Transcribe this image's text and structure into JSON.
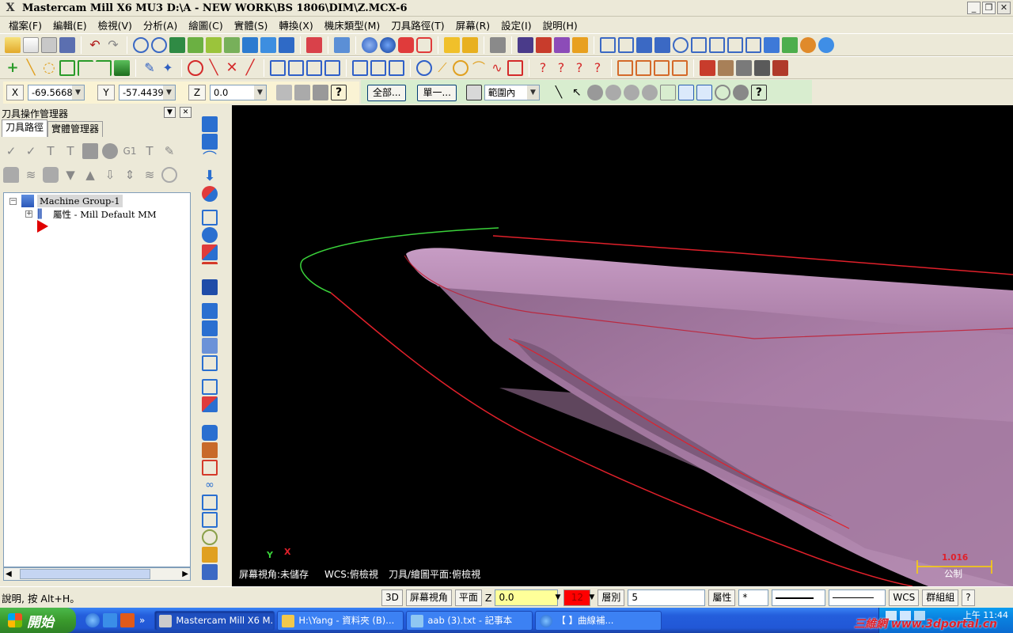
{
  "window": {
    "title": "Mastercam Mill X6 MU3  D:\\A - NEW WORK\\BS 1806\\DIM\\Z.MCX-6"
  },
  "menu": [
    "檔案(F)",
    "編輯(E)",
    "檢視(V)",
    "分析(A)",
    "繪圖(C)",
    "實體(S)",
    "轉換(X)",
    "機床類型(M)",
    "刀具路徑(T)",
    "屏幕(R)",
    "設定(I)",
    "說明(H)"
  ],
  "coords": {
    "x_label": "X",
    "x_value": "-69.56687",
    "y_label": "Y",
    "y_value": "-57.44398",
    "z_label": "Z",
    "z_value": "0.0"
  },
  "selection": {
    "all_button": "全部...",
    "single_button": "單一...",
    "mode": "範圍內"
  },
  "panel": {
    "title": "刀具操作管理器",
    "tabs": [
      "刀具路徑",
      "實體管理器"
    ],
    "tree": {
      "group": "Machine Group-1",
      "properties": "屬性 - Mill Default MM"
    }
  },
  "viewport": {
    "status_view": "屏幕視角:未儲存",
    "status_wcs": "WCS:俯檢視",
    "status_plane": "刀具/繪圖平面:俯檢視",
    "scale_value": "1.016",
    "scale_unit": "公制",
    "axis_y": "Y",
    "axis_x": "X"
  },
  "status": {
    "help": "說明, 按 Alt+H。",
    "mode3d": "3D",
    "screen_view": "屏幕視角",
    "plane": "平面",
    "z_label": "Z",
    "z_value": "0.0",
    "color_value": "12",
    "layer_label": "層別",
    "layer_value": "5",
    "attributes": "屬性",
    "point_style": "*",
    "wcs": "WCS",
    "group": "群組組",
    "help_btn": "?"
  },
  "taskbar": {
    "start": "開始",
    "tasks": [
      "Mastercam Mill X6 M...",
      "H:\\Yang - 資料夾 (B)...",
      "aab (3).txt - 記事本",
      "【         】曲線補..."
    ],
    "clock": "上午 11:44",
    "watermark": "三維網 www.3dportal.cn"
  },
  "colors": {
    "viewport_bg": "#000000",
    "hull": "#b784b4",
    "curve_red": "#e0202a",
    "curve_green": "#3ad23a",
    "active_color": "#ff0000"
  }
}
